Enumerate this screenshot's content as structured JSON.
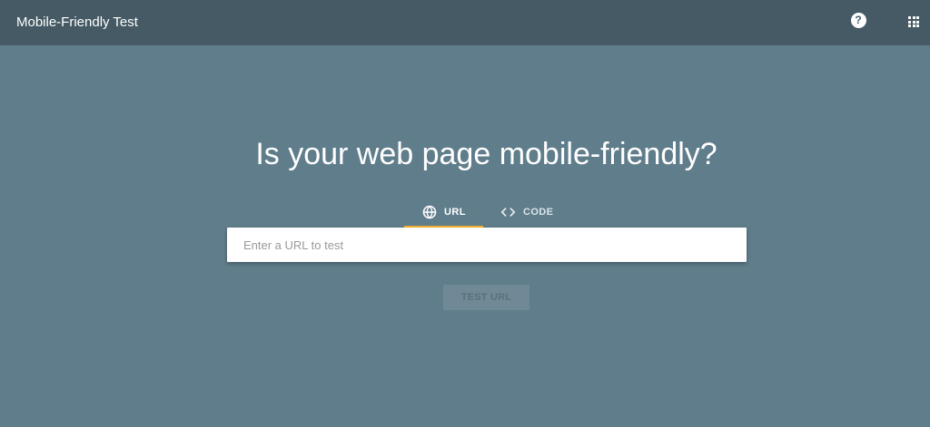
{
  "header": {
    "title": "Mobile-Friendly Test",
    "help_icon": "help-circle-icon",
    "help_glyph": "?",
    "apps_icon": "apps-grid-icon"
  },
  "main": {
    "headline": "Is your web page mobile-friendly?",
    "tabs": [
      {
        "label": "URL",
        "icon": "globe-icon",
        "selected": true
      },
      {
        "label": "CODE",
        "icon": "code-icon",
        "selected": false
      }
    ],
    "url_input": {
      "value": "",
      "placeholder": "Enter a URL to test"
    },
    "test_button": {
      "label": "TEST URL",
      "enabled": false
    }
  },
  "colors": {
    "background": "#607d8b",
    "header": "#455a64",
    "tab_indicator": "#f6ae2d",
    "input_background": "#ffffff",
    "disabled_button": "#6f8a96"
  }
}
